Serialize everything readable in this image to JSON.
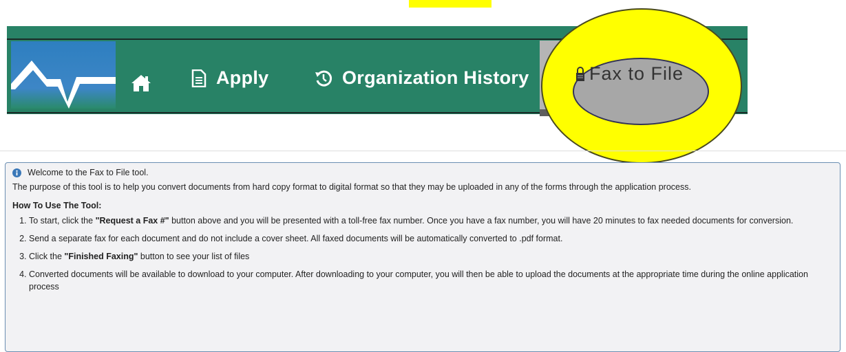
{
  "navbar": {
    "apply_label": "Apply",
    "history_label": "Organization History",
    "fax_label": "Fax to File",
    "icons": [
      "home-icon",
      "document-icon",
      "history-icon",
      "lock-icon"
    ],
    "colors": {
      "bar": "#288266",
      "active_tab": "#b5b5b5",
      "highlight": "#ffff00"
    }
  },
  "info": {
    "welcome": "Welcome to the Fax to File tool.",
    "purpose": "The purpose of this tool is to help you convert documents from hard copy format to digital format so that they may be uploaded in any of the forms through the application process.",
    "howto_title": "How To Use The Tool:",
    "steps": [
      {
        "pre": "To start, click the ",
        "bold": "\"Request a Fax #\"",
        "post": " button above and you will be presented with a toll-free fax number. Once you have a fax number, you will have 20 minutes to fax needed documents for conversion."
      },
      {
        "pre": "Send a separate fax for each document and do not include a cover sheet. All faxed documents will be automatically converted to .pdf format.",
        "bold": "",
        "post": ""
      },
      {
        "pre": "Click the ",
        "bold": "\"Finished Faxing\"",
        "post": " button to see your list of files"
      },
      {
        "pre": "Converted documents will be available to download to your computer. After downloading to your computer, you will then be able to upload the documents at the appropriate time during the online application process",
        "bold": "",
        "post": ""
      }
    ]
  }
}
